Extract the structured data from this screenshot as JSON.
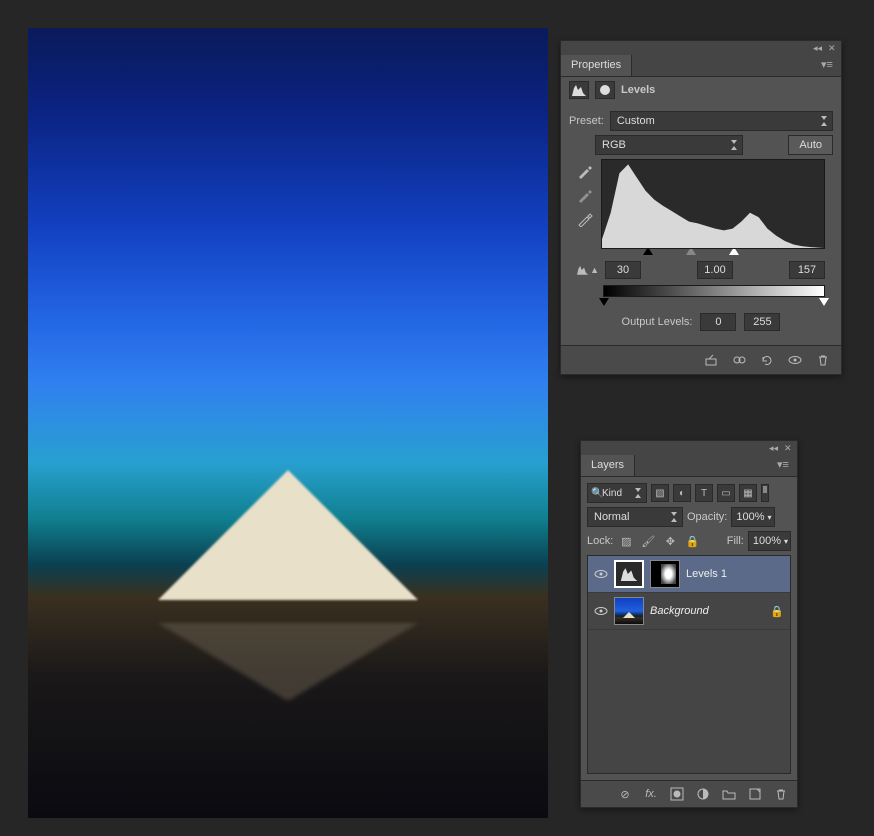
{
  "properties": {
    "tab": "Properties",
    "title": "Levels",
    "preset_label": "Preset:",
    "preset_value": "Custom",
    "channel_value": "RGB",
    "auto_label": "Auto",
    "input": {
      "black": "30",
      "gamma": "1.00",
      "white": "157"
    },
    "output_label": "Output Levels:",
    "output": {
      "black": "0",
      "white": "255"
    }
  },
  "layers": {
    "tab": "Layers",
    "kind_label": "Kind",
    "blend_mode": "Normal",
    "opacity_label": "Opacity:",
    "opacity_value": "100%",
    "lock_label": "Lock:",
    "fill_label": "Fill:",
    "fill_value": "100%",
    "items": [
      {
        "name": "Levels 1",
        "type": "adjustment",
        "selected": true
      },
      {
        "name": "Background",
        "type": "image",
        "locked": true
      }
    ]
  },
  "chart_data": {
    "type": "area",
    "title": "Histogram (RGB)",
    "xlabel": "",
    "ylabel": "",
    "xlim": [
      0,
      255
    ],
    "ylim": [
      0,
      100
    ],
    "x": [
      0,
      10,
      20,
      30,
      40,
      50,
      60,
      70,
      80,
      90,
      100,
      110,
      120,
      130,
      140,
      150,
      160,
      170,
      180,
      190,
      200,
      210,
      220,
      230,
      240,
      255
    ],
    "values": [
      10,
      40,
      85,
      95,
      80,
      65,
      55,
      48,
      42,
      36,
      30,
      28,
      25,
      22,
      20,
      22,
      30,
      40,
      35,
      22,
      14,
      8,
      4,
      2,
      1,
      0
    ],
    "input_markers": {
      "black": 30,
      "gamma": 1.0,
      "white": 157
    },
    "output_markers": {
      "black": 0,
      "white": 255
    }
  }
}
